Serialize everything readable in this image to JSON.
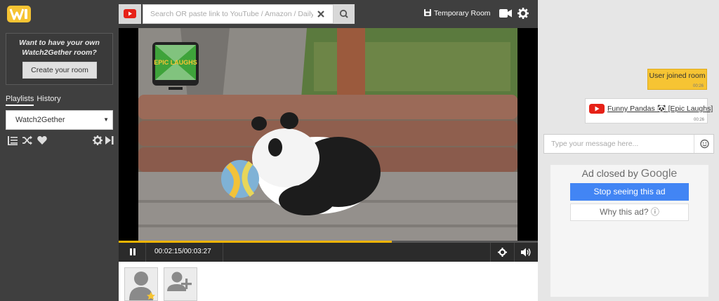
{
  "app": {
    "name": "Watch2Gether",
    "brand_color": "#f6c433"
  },
  "sidebar": {
    "promo_text": "Want to have your own Watch2Gether room?",
    "create_room_label": "Create your room",
    "tabs": [
      {
        "label": "Playlists",
        "active": true
      },
      {
        "label": "History",
        "active": false
      }
    ],
    "playlist_selected": "Watch2Gether",
    "actions": [
      "list-add-icon",
      "shuffle-icon",
      "heart-icon",
      "gear-icon",
      "skip-next-icon"
    ]
  },
  "topbar": {
    "search_placeholder": "Search OR paste link to YouTube / Amazon / Daily",
    "room_name": "Temporary Room"
  },
  "player": {
    "current_time": "00:02:15",
    "total_time": "00:03:27",
    "progress": 0.652,
    "progress_color": "#f0b400",
    "logo_text": "EPIC LAUGHS"
  },
  "chat": {
    "messages": [
      {
        "type": "system",
        "text": "User joined room",
        "time": "00:26"
      },
      {
        "type": "video",
        "text": "Funny Pandas 🐼 [Epic Laughs]",
        "time": "00:26"
      }
    ],
    "input_placeholder": "Type your message here..."
  },
  "ad": {
    "closed_prefix": "Ad closed by",
    "closed_brand": "Google",
    "stop_label": "Stop seeing this ad",
    "why_label": "Why this ad? ⓘ"
  }
}
